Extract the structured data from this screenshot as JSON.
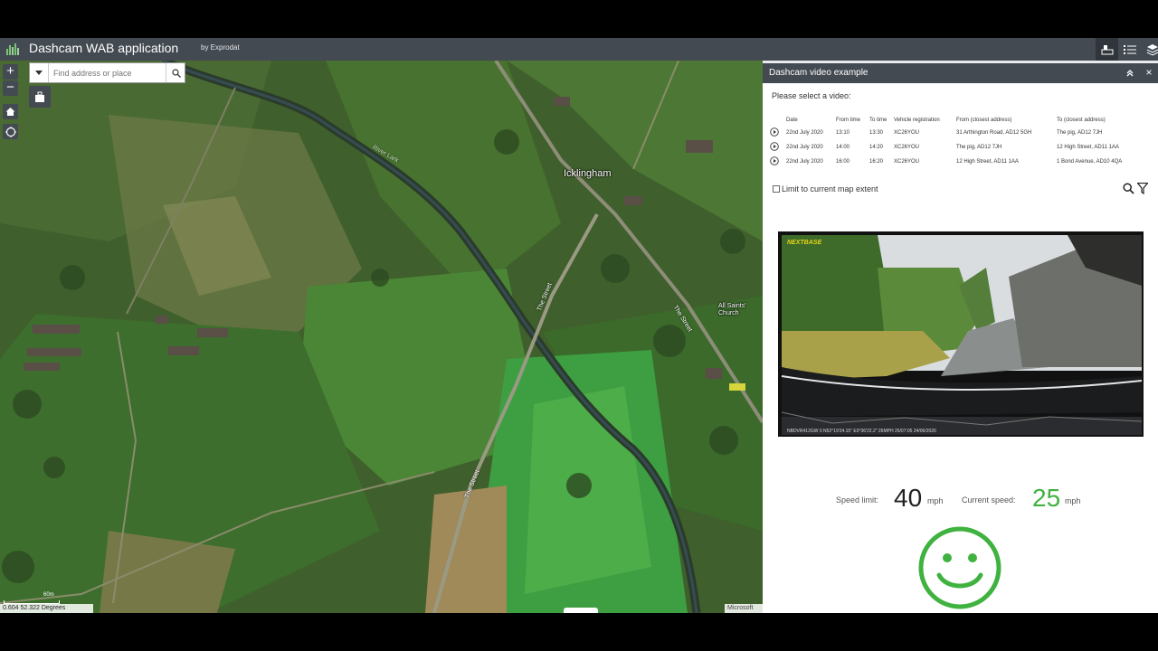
{
  "header": {
    "title": "Dashcam WAB application",
    "subtitle": "by Exprodat",
    "icons": [
      "attribute-table-icon",
      "layer-list-icon",
      "layers-icon"
    ]
  },
  "map": {
    "search": {
      "placeholder": "Find address or place"
    },
    "zoom_in": "+",
    "zoom_out": "−",
    "town_label": "Icklingham",
    "church_label_1": "All Saints'",
    "church_label_2": "Church",
    "road_label": "The Street",
    "river_label": "River Lark",
    "scale": "60m",
    "coordinates": "0.604 52.322 Degrees",
    "attribution": "Microsoft"
  },
  "panel": {
    "title": "Dashcam video example",
    "collapse": "⌃",
    "close": "×",
    "prompt": "Please select a video:",
    "table": {
      "headers": [
        "Date",
        "From time",
        "To time",
        "Vehicle registration",
        "From (closest address)",
        "To (closest address)"
      ],
      "rows": [
        [
          "22nd July 2020",
          "13:10",
          "13:30",
          "XC26YOU",
          "31 Arthington Road, AD12 5GH",
          "The pig, AD12 7JH"
        ],
        [
          "22nd July 2020",
          "14:00",
          "14:20",
          "XC26YOU",
          "The pig, AD12 7JH",
          "12 High Street, AD11 1AA"
        ],
        [
          "22nd July 2020",
          "16:00",
          "16:20",
          "XC26YOU",
          "12 High Street, AD11 1AA",
          "1 Bond Avenue, AD10 4QA"
        ]
      ]
    },
    "limit_label": "Limit to current map extent",
    "video": {
      "brand": "NEXTBASE",
      "overlay": "NBDVR412GW 0     N52°19'24.15\" E0°36'22.2\"  26MPH 25/07:05 24/06/2020"
    },
    "speed": {
      "limit_label": "Speed limit:",
      "limit_value": "40",
      "limit_unit": "mph",
      "current_label": "Current speed:",
      "current_value": "25",
      "current_unit": "mph",
      "status_icon": "smiley-face-icon",
      "status_color": "#3fb23f"
    }
  }
}
